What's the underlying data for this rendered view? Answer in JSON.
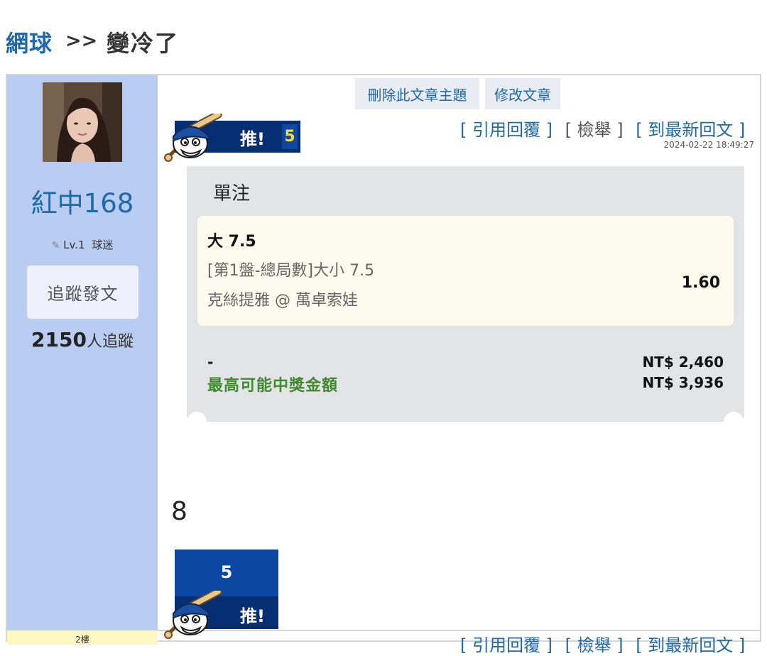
{
  "breadcrumb": {
    "category": "網球",
    "separator": ">>",
    "title": "變冷了"
  },
  "author": {
    "name": "紅中168",
    "level": "Lv.1",
    "level_label": "球迷",
    "follow_label": "追蹤發文",
    "follower_count": "2150",
    "follower_suffix": "人追蹤"
  },
  "toolbar": {
    "delete_topic": "刪除此文章主題",
    "edit_post": "修改文章"
  },
  "post": {
    "push_label": "推!",
    "push_count": "5",
    "actions": {
      "quote_reply": "[ 引用回覆 ]",
      "report": "[ 檢舉 ]",
      "latest_reply": "[ 到最新回文 ]"
    },
    "timestamp": "2024-02-22 18:49:27",
    "body": "8"
  },
  "bet": {
    "type": "單注",
    "selection_name": "大 7.5",
    "market": "[第1盤-總局數]大小 7.5",
    "match": "克絲提雅 @ 萬卓索娃",
    "odds": "1.60",
    "stake_label": "-",
    "stake_amount": "NT$ 2,460",
    "payout_label": "最高可能中獎金額",
    "payout_amount": "NT$ 3,936"
  },
  "next_post": {
    "floor_label": "2樓"
  },
  "colors": {
    "link": "#1f69a8",
    "sidebar": "#b9ccf2",
    "push_dark": "#062e73",
    "push_blue": "#0c47a3",
    "push_count": "#ffd93a",
    "payout_green": "#3f8a2f"
  },
  "icons": {
    "mascot": "baseball-mascot-icon",
    "level": "pencil-icon"
  }
}
